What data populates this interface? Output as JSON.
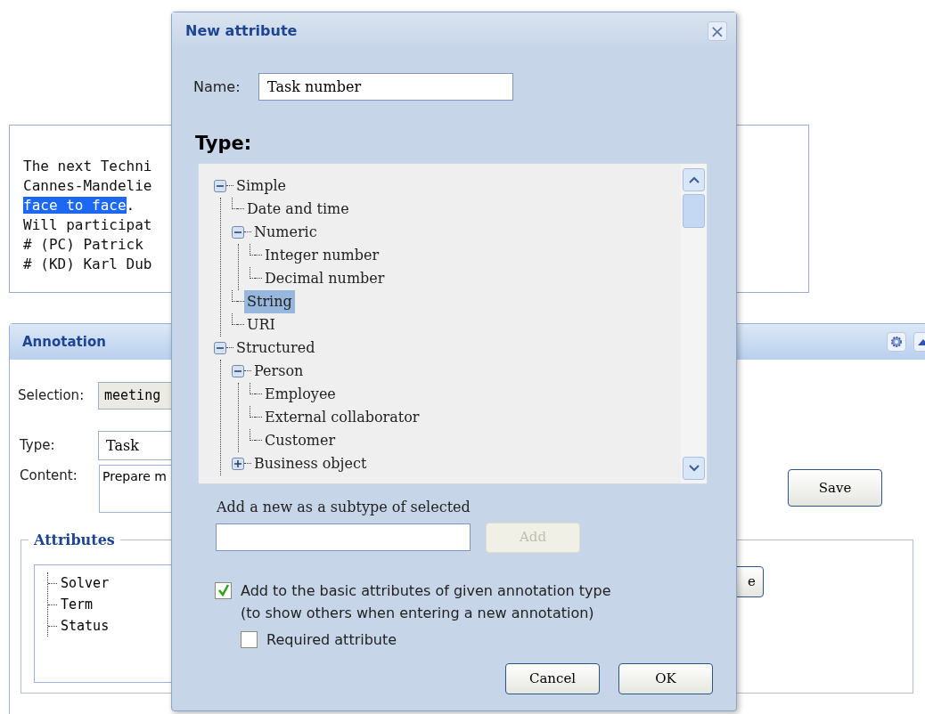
{
  "document": {
    "lines": [
      {
        "segments": [
          {
            "text": "The next Techni",
            "selected": false
          }
        ]
      },
      {
        "segments": [
          {
            "text": "Cannes-Mandelie",
            "selected": false
          }
        ]
      },
      {
        "segments": [
          {
            "text": "face to face",
            "selected": true
          },
          {
            "text": ".",
            "selected": false
          }
        ]
      },
      {
        "segments": [
          {
            "text": "Will participat",
            "selected": false
          }
        ]
      },
      {
        "segments": [
          {
            "text": "# (PC) Patrick",
            "selected": false
          }
        ]
      },
      {
        "segments": [
          {
            "text": "# (KD) Karl Dub",
            "selected": false
          }
        ]
      }
    ]
  },
  "annotation": {
    "title": "Annotation",
    "selection": {
      "label": "Selection:",
      "value": "meeting"
    },
    "type": {
      "label": "Type:",
      "value": "Task"
    },
    "content": {
      "label": "Content:",
      "value": "Prepare m"
    },
    "save_button": "Save",
    "attributes": {
      "legend": "Attributes",
      "items": [
        "Solver",
        "Term",
        "Status"
      ],
      "button": "e"
    }
  },
  "dialog": {
    "title": "New attribute",
    "close": "×",
    "name": {
      "label": "Name:",
      "value": "Task number"
    },
    "type_heading": "Type:",
    "tree": [
      {
        "label": "Simple",
        "expanded": true,
        "selected": false,
        "children": [
          {
            "label": "Date and time",
            "selected": false
          },
          {
            "label": "Numeric",
            "expanded": true,
            "selected": false,
            "children": [
              {
                "label": "Integer number",
                "selected": false
              },
              {
                "label": "Decimal number",
                "selected": false
              }
            ]
          },
          {
            "label": "String",
            "selected": true
          },
          {
            "label": "URI",
            "selected": false
          }
        ]
      },
      {
        "label": "Structured",
        "expanded": true,
        "selected": false,
        "children": [
          {
            "label": "Person",
            "expanded": true,
            "selected": false,
            "children": [
              {
                "label": "Employee",
                "selected": false
              },
              {
                "label": "External collaborator",
                "selected": false
              },
              {
                "label": "Customer",
                "selected": false
              }
            ]
          },
          {
            "label": "Business object",
            "expanded": false,
            "selected": false
          }
        ]
      }
    ],
    "subtype_label": "Add a new as a subtype of selected",
    "add_button": {
      "label": "Add",
      "disabled": true
    },
    "options": [
      {
        "label": "Add to the basic attributes of given annotation type",
        "note": "(to show others when entering a new annotation)",
        "checked": true
      },
      {
        "label": "Required attribute",
        "checked": false
      }
    ],
    "buttons": [
      "Cancel",
      "OK"
    ]
  }
}
